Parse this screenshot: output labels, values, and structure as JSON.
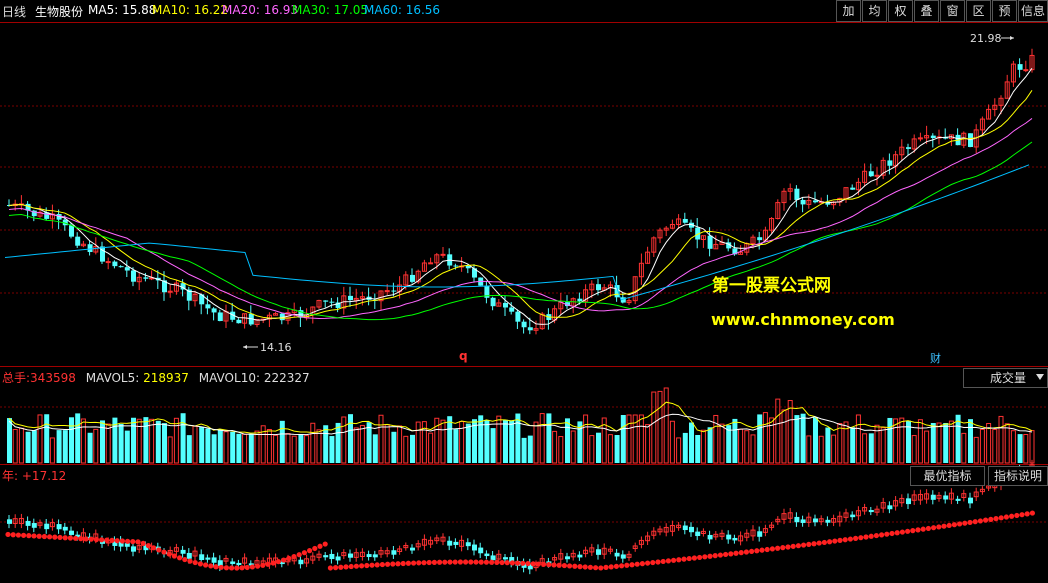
{
  "header": {
    "period": "日线",
    "stock_name": "生物股份",
    "ma": [
      {
        "label": "MA5:",
        "value": "15.88",
        "color": "#ffffff"
      },
      {
        "label": "MA10:",
        "value": "16.22",
        "color": "#ffff00"
      },
      {
        "label": "MA20:",
        "value": "16.93",
        "color": "#ff66ff"
      },
      {
        "label": "MA30:",
        "value": "17.05",
        "color": "#00ff00"
      },
      {
        "label": "MA60:",
        "value": "16.56",
        "color": "#00bfff"
      }
    ],
    "buttons": [
      "加",
      "均",
      "权",
      "叠",
      "窗",
      "区",
      "预",
      "信息"
    ]
  },
  "price_chart": {
    "high_marker": "21.98",
    "low_marker": "14.16",
    "event_q": "q",
    "event_cai": "财",
    "watermark_line1": "第一股票公式网",
    "watermark_line2": "www.chnmoney.com"
  },
  "volume_panel": {
    "total_label": "总手:",
    "total_value": "343598",
    "mavol5_label": "MAVOL5:",
    "mavol5_value": "218937",
    "mavol10_label": "MAVOL10:",
    "mavol10_value": "222327",
    "dropdown_label": "成交量"
  },
  "indicator_panel": {
    "label": "年:",
    "value": "+17.12",
    "best_button": "最优指标",
    "explain_button": "指标说明"
  },
  "colors": {
    "up": "#ff3232",
    "down": "#54ffff",
    "grid": "#7a0000",
    "ma5": "#ffffff",
    "ma10": "#ffff00",
    "ma20": "#ff66ff",
    "ma30": "#00ff00",
    "ma60": "#00bfff"
  }
}
